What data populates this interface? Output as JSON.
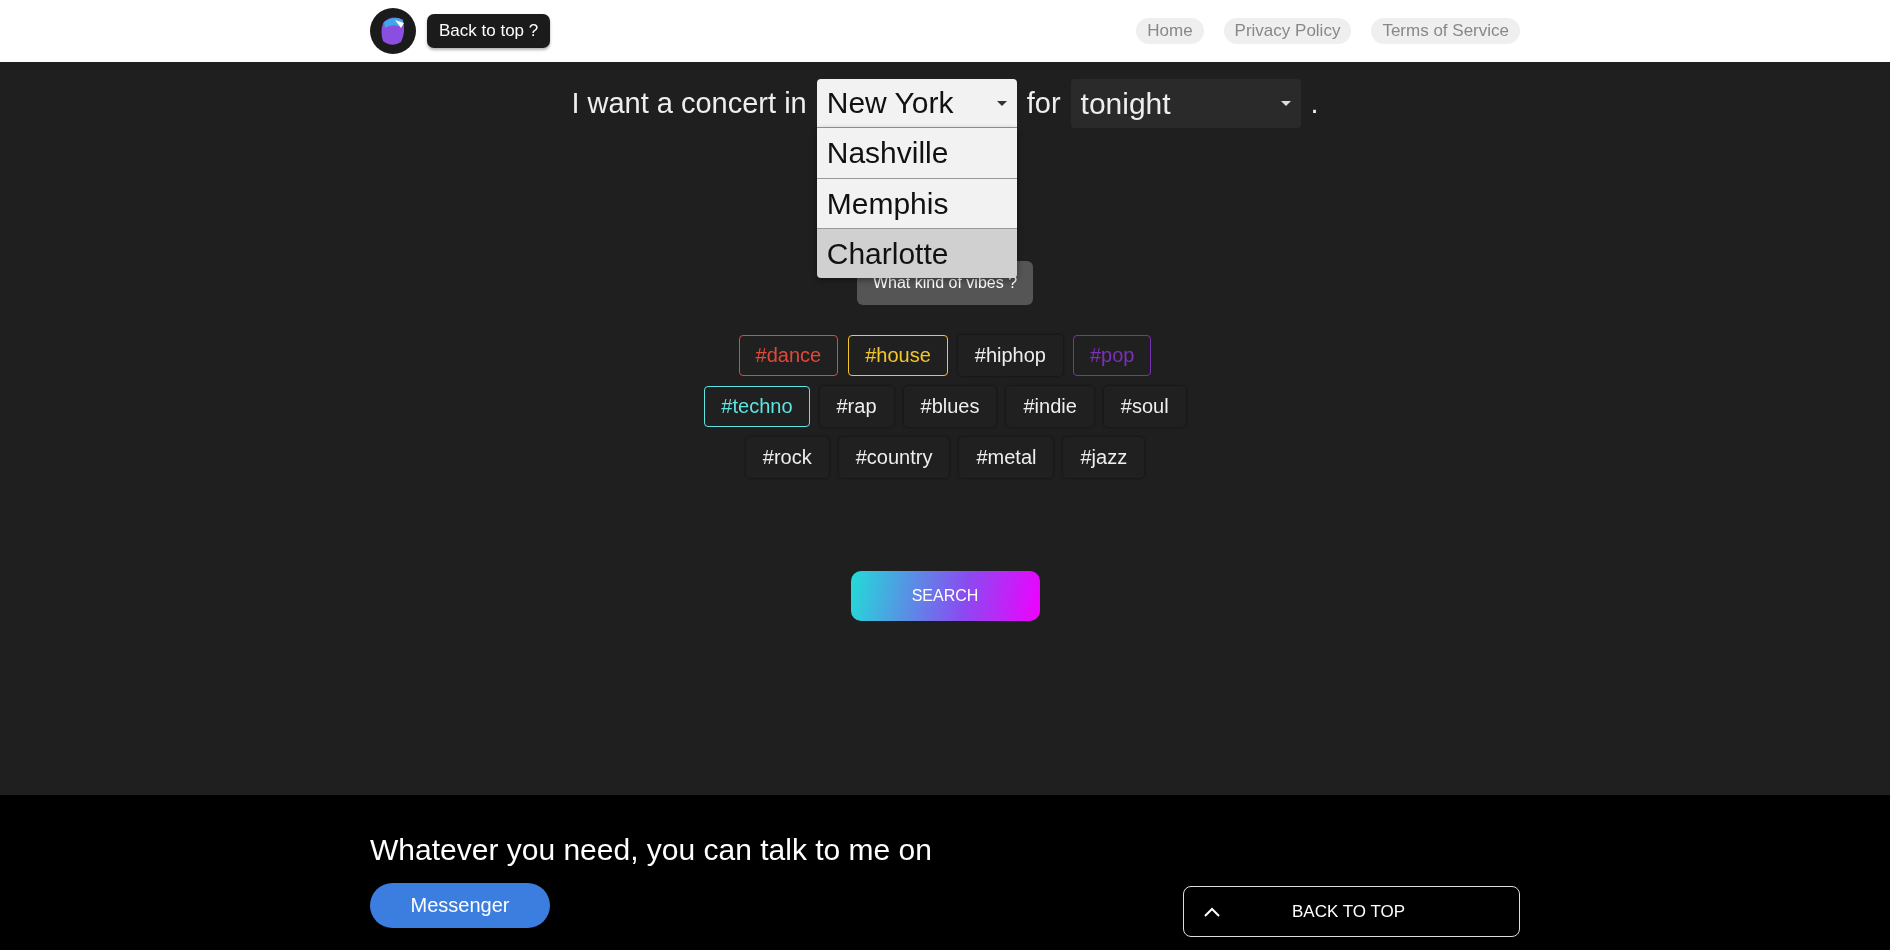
{
  "header": {
    "back_to_top_tip": "Back to top ?",
    "nav": [
      "Home",
      "Privacy Policy",
      "Terms of Service"
    ]
  },
  "query": {
    "prefix": "I want a concert in",
    "city": {
      "value": "New York",
      "expanded": true,
      "options": [
        {
          "label": "Nashville",
          "selected": false
        },
        {
          "label": "Memphis",
          "selected": false
        },
        {
          "label": "Charlotte",
          "selected": true
        }
      ]
    },
    "joiner": "for",
    "time": {
      "value": "tonight",
      "expanded": false
    },
    "suffix": "."
  },
  "vibes_tip": "What kind of vibes ?",
  "tag_rows": [
    [
      {
        "label": "#dance",
        "selected": true,
        "color": "#e0483a"
      },
      {
        "label": "#house",
        "selected": true,
        "color": "#f2c72c"
      },
      {
        "label": "#hiphop",
        "selected": false
      },
      {
        "label": "#pop",
        "selected": true,
        "color": "#7b30b5"
      }
    ],
    [
      {
        "label": "#techno",
        "selected": true,
        "color": "#5fe3e3"
      },
      {
        "label": "#rap",
        "selected": false
      },
      {
        "label": "#blues",
        "selected": false
      },
      {
        "label": "#indie",
        "selected": false
      },
      {
        "label": "#soul",
        "selected": false
      }
    ],
    [
      {
        "label": "#rock",
        "selected": false
      },
      {
        "label": "#country",
        "selected": false
      },
      {
        "label": "#metal",
        "selected": false
      },
      {
        "label": "#jazz",
        "selected": false
      }
    ]
  ],
  "search_button": "SEARCH",
  "footer": {
    "tagline": "Whatever you need, you can talk to me on",
    "messenger": "Messenger",
    "back_to_top": "BACK TO TOP"
  }
}
